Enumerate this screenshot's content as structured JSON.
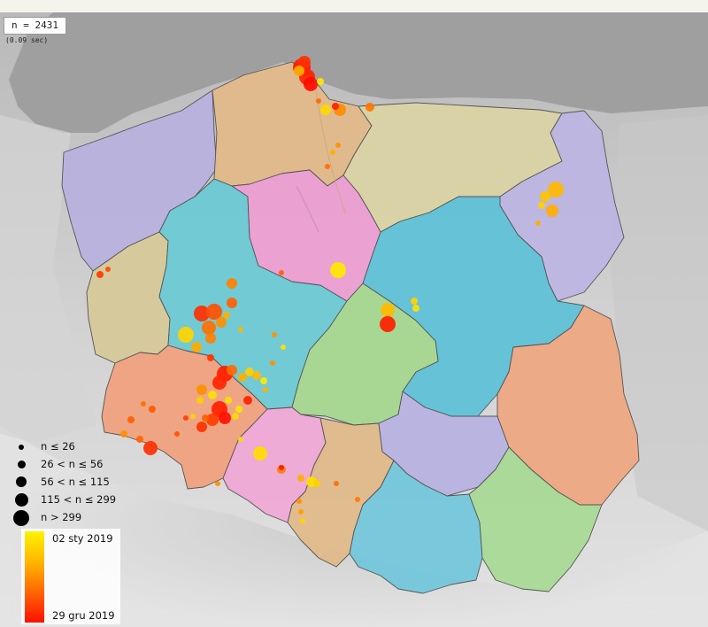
{
  "header": {
    "count_label": "n = 2431",
    "timing_label": "(0.09 sec)"
  },
  "legend": {
    "sizes": [
      {
        "label": "n ≤ 26"
      },
      {
        "label": "26 < n ≤ 56"
      },
      {
        "label": "56 < n ≤ 115"
      },
      {
        "label": "115 < n ≤ 299"
      },
      {
        "label": "n > 299"
      }
    ],
    "color_scale": {
      "top_label": "02 sty 2019",
      "bottom_label": "29 gru 2019",
      "top_color": "#fff200",
      "bottom_color": "#ff1000"
    }
  },
  "map": {
    "regions": [
      {
        "id": "zachodniopomorskie",
        "color": "#b7b1de"
      },
      {
        "id": "pomorskie",
        "color": "#e2b98a"
      },
      {
        "id": "warminsko-mazurskie",
        "color": "#d9d3a4"
      },
      {
        "id": "podlaskie",
        "color": "#bcb5e2"
      },
      {
        "id": "lubuskie",
        "color": "#d6c99a"
      },
      {
        "id": "wielkopolskie",
        "color": "#6bc9d4"
      },
      {
        "id": "kujawsko-pomorskie",
        "color": "#ec9ed2"
      },
      {
        "id": "mazowieckie",
        "color": "#5fc1d7"
      },
      {
        "id": "lodzkie",
        "color": "#a4d78e"
      },
      {
        "id": "lubelskie",
        "color": "#eea882"
      },
      {
        "id": "dolnoslaskie",
        "color": "#f0a27e"
      },
      {
        "id": "opolskie",
        "color": "#eea9d6"
      },
      {
        "id": "slaskie",
        "color": "#e0b98a"
      },
      {
        "id": "swietokrzyskie",
        "color": "#b8b2e2"
      },
      {
        "id": "malopolskie",
        "color": "#74c6da"
      },
      {
        "id": "podkarpackie",
        "color": "#a8d996"
      }
    ]
  }
}
